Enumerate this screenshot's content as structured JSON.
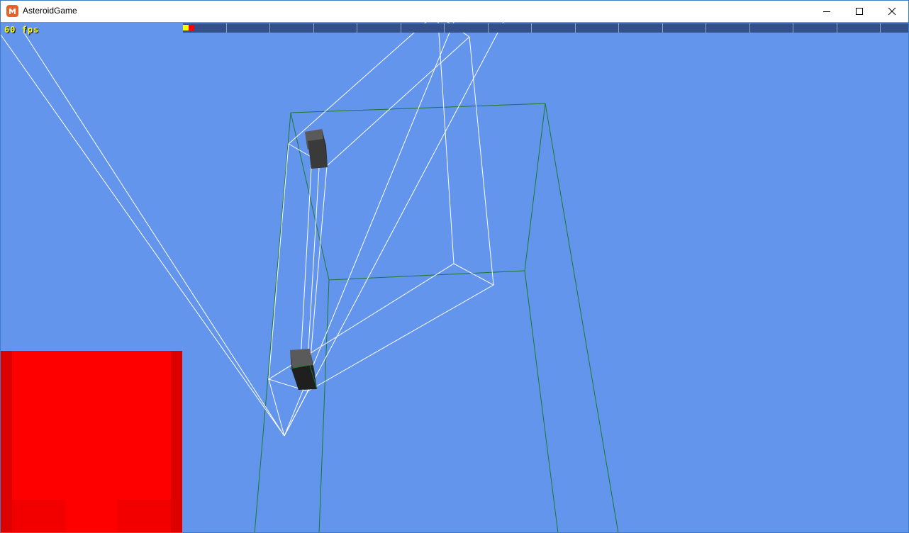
{
  "window": {
    "title": "AsteroidGame",
    "icon": "monogame-logo-icon",
    "controls": {
      "minimize": "minimize-icon",
      "maximize": "maximize-icon",
      "close": "close-icon"
    }
  },
  "hud": {
    "fps": "60 fps",
    "fps_color": "#ffff00"
  },
  "timeline": {
    "segments": 16,
    "marker_colors": [
      "#ffff00",
      "#ff0000"
    ],
    "bar_color": "#34508a"
  },
  "scene": {
    "background_color": "#6495ed",
    "wireframe_colors": {
      "camera_frustum": "#ffffff",
      "bounding_box": "#1a7a2a"
    },
    "objects": [
      "upper-cube",
      "lower-cube"
    ],
    "render_target_color": "#ff0000"
  }
}
